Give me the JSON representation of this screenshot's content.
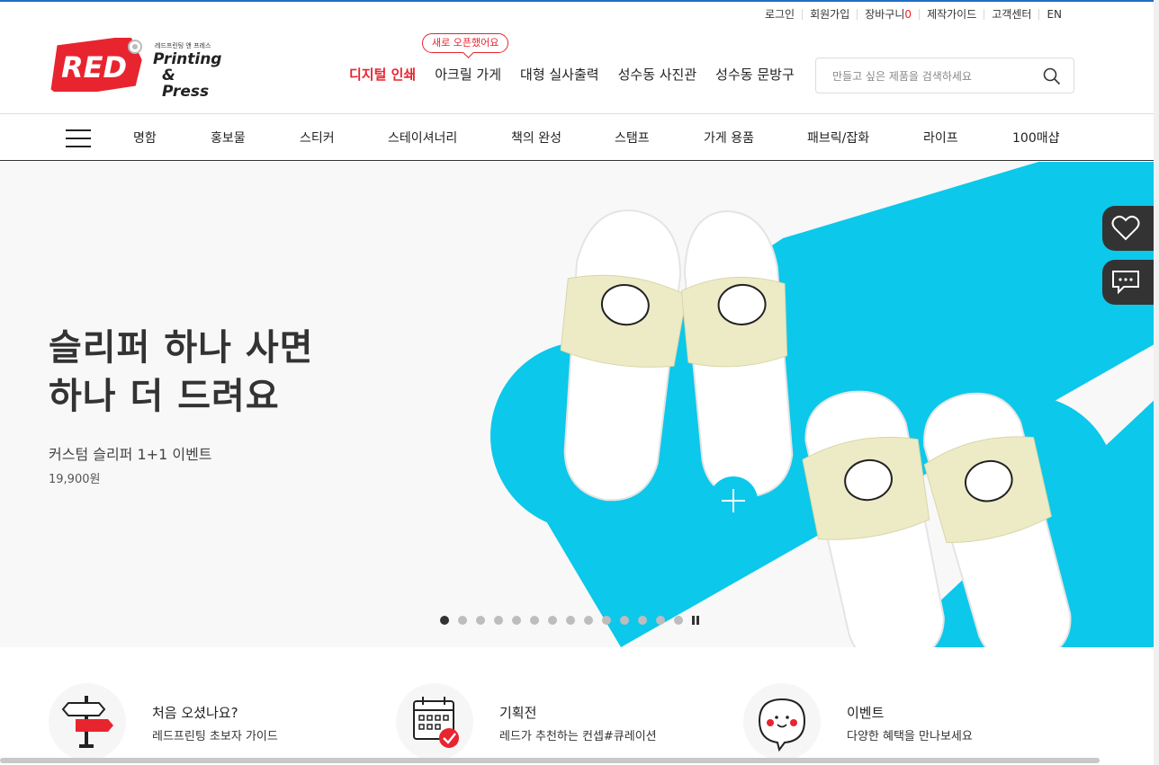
{
  "header": {
    "utility": [
      {
        "label": "로그인"
      },
      {
        "label": "회원가입"
      },
      {
        "label": "장바구니",
        "count": "0"
      },
      {
        "label": "제작가이드"
      },
      {
        "label": "고객센터"
      },
      {
        "label": "EN"
      }
    ],
    "logo": {
      "tag_text": "RED",
      "small_text": "레드프린팅 앤 프레스",
      "line1": "Printing",
      "line2": "& Press"
    },
    "new_badge": "새로 오픈했어요",
    "menu": [
      "디지털 인쇄",
      "아크릴 가게",
      "대형 실사출력",
      "성수동 사진관",
      "성수동 문방구"
    ],
    "search": {
      "placeholder": "만들고 싶은 제품을 검색하세요",
      "value": ""
    }
  },
  "categories": [
    "명함",
    "홍보물",
    "스티커",
    "스테이셔너리",
    "책의 완성",
    "스탬프",
    "가게 용품",
    "패브릭/잡화",
    "라이프",
    "100매샵"
  ],
  "hero": {
    "title": "슬리퍼 하나 사면\n하나 더 드려요",
    "subtitle": "커스텀 슬리퍼 1+1 이벤트",
    "price": "19,900원",
    "slide_count": 14,
    "active_slide": 0
  },
  "side_buttons": [
    {
      "icon": "heart-icon"
    },
    {
      "icon": "chat-icon"
    }
  ],
  "info_cards": [
    {
      "title": "처음 오셨나요?",
      "desc": "레드프린팅 초보자 가이드",
      "icon": "signpost-icon"
    },
    {
      "title": "기획전",
      "desc": "레드가 추천하는 컨셉#큐레이션",
      "icon": "calendar-check-icon"
    },
    {
      "title": "이벤트",
      "desc": "다양한 혜택을 만나보세요",
      "icon": "smile-bubble-icon"
    }
  ],
  "colors": {
    "brand_red": "#e8242f",
    "accent_cyan": "#0cc8ea",
    "dark": "#333333"
  }
}
